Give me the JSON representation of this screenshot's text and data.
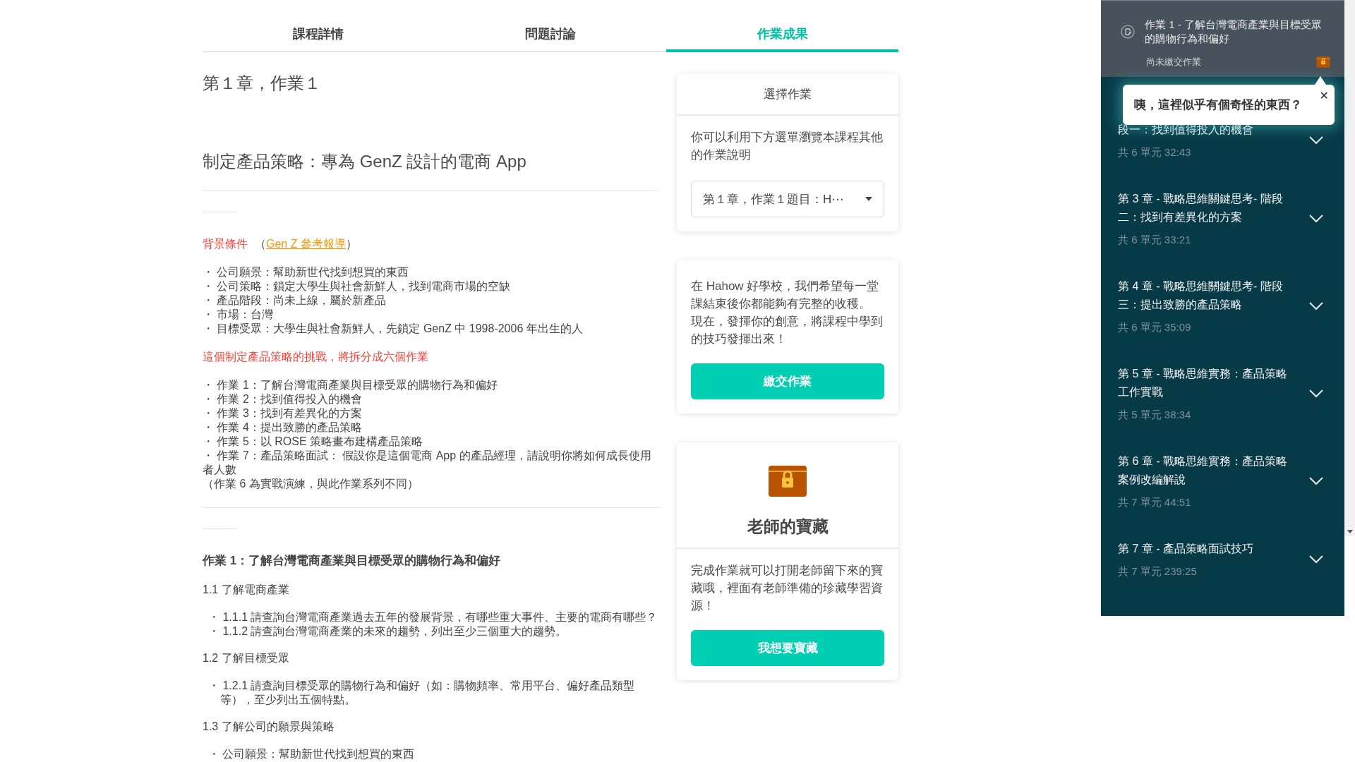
{
  "tabs": [
    {
      "label": "課程詳情",
      "selected": false
    },
    {
      "label": "問題討論",
      "selected": false
    },
    {
      "label": "作業成果",
      "selected": true
    }
  ],
  "content": {
    "blocks": [
      {
        "kind": "title",
        "text": "第１章，作業１"
      },
      {
        "kind": "subtitle",
        "text": "制定產品策略：專為 GenZ 設計的電商 App"
      },
      {
        "kind": "rule"
      },
      {
        "kind": "short_rule"
      },
      {
        "kind": "label_link",
        "label": "背景條件",
        "open": "（",
        "link": "Gen Z 參考報導",
        "close": "）"
      },
      {
        "kind": "list",
        "items": [
          "・ 公司願景：幫助新世代找到想買的東西",
          "・ 公司策略：鎖定大學生與社會新鮮人，找到電商市場的空缺",
          "・ 產品階段：尚未上線，屬於新產品",
          "・ 市場：台灣",
          "・ 目標受眾：大學生與社會新鮮人，先鎖定 GenZ 中 1998-2006 年出生的人"
        ]
      },
      {
        "kind": "highlight",
        "text": "這個制定產品策略的挑戰，將拆分成六個作業"
      },
      {
        "kind": "list",
        "items": [
          "・ 作業 1：了解台灣電商產業與目標受眾的購物行為和偏好",
          "・ 作業 2：找到值得投入的機會",
          "・ 作業 3：找到有差異化的方案",
          "・ 作業 4：提出致勝的產品策略",
          "・ 作業 5：以 ROSE 策略畫布建構產品策略",
          "・ 作業 7：產品策略面試： 假設你是這個電商 App 的產品經理，請說明你將如何成長使用者人數",
          "（作業 6 為實戰演練，與此作業系列不同）"
        ]
      },
      {
        "kind": "rule"
      },
      {
        "kind": "short_rule"
      },
      {
        "kind": "heading",
        "text": "作業 1：了解台灣電商產業與目標受眾的購物行為和偏好"
      },
      {
        "kind": "section",
        "text": "1.1 了解電商產業"
      },
      {
        "kind": "sublist",
        "items": [
          "・ 1.1.1 請查詢台灣電商產業過去五年的發展背景，有哪些重大事件、主要的電商有哪些？",
          "・ 1.1.2 請查詢台灣電商產業的未來的趨勢，列出至少三個重大的趨勢。"
        ]
      },
      {
        "kind": "section",
        "text": "1.2 了解目標受眾"
      },
      {
        "kind": "sublist",
        "items": [
          "・ 1.2.1 請查詢目標受眾的購物行為和偏好（如：購物頻率、常用平台、偏好產品類型等），至少列出五個特點。"
        ]
      },
      {
        "kind": "section",
        "text": "1.3 了解公司的願景與策略"
      },
      {
        "kind": "sublist",
        "items": [
          "・ 公司願景：幫助新世代找到想買的東西"
        ]
      }
    ]
  },
  "select_card": {
    "title": "選擇作業",
    "text": "你可以利用下方選單瀏覽本課程其他的作業說明",
    "select": {
      "value": "第１章，作業１題目：H⋯"
    }
  },
  "submit_card": {
    "paragraphs": [
      "在 Hahow 好學校，我們希望每一堂課結束後你都能夠有完整的收穫。",
      "現在，發揮你的創意，將課程中學到的技巧發揮出來！"
    ],
    "button": "繳交作業"
  },
  "treasure_card": {
    "title": "老師的寶藏",
    "text": "完成作業就可以打開老師留下來的寶藏哦，裡面有老師準備的珍藏學習資源！",
    "button": "我想要寶藏"
  },
  "sidebar": {
    "current": {
      "title": "作業 1 - 了解台灣電商產業與目標受眾的購物行為和偏好",
      "status": "尚未繳交作業"
    },
    "tooltip": {
      "text": "咦，這裡似乎有個奇怪的東西？",
      "close": "✕"
    },
    "chapters": [
      {
        "title": "段一：找到值得投入的機會",
        "meta": "共 6 單元 32:43",
        "expanded": false
      },
      {
        "title": "第 3 章 - 戰略思維關鍵思考- 階段二：找到有差異化的方案",
        "meta": "共 6 單元 33:21",
        "expanded": false
      },
      {
        "title": "第 4 章 - 戰略思維關鍵思考- 階段三：提出致勝的產品策略",
        "meta": "共 6 單元 35:09",
        "expanded": false
      },
      {
        "title": "第 5 章 - 戰略思維實務：產品策略工作實戰",
        "meta": "共 5 單元 38:34",
        "expanded": false
      },
      {
        "title": "第 6 章 - 戰略思維實務：產品策略案例改編解說",
        "meta": "共 7 單元 44:51",
        "expanded": false
      },
      {
        "title": "第 7 章 - 產品策略面試技巧",
        "meta": "共 7 單元 239:25",
        "expanded": false
      }
    ]
  }
}
